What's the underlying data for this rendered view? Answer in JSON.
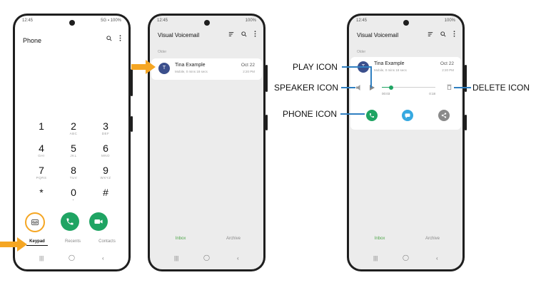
{
  "phone1": {
    "status_time": "12:45",
    "status_right": "5G",
    "status_battery": "100%",
    "title": "Phone",
    "keys": [
      {
        "digit": "1",
        "letters": ""
      },
      {
        "digit": "2",
        "letters": "ABC"
      },
      {
        "digit": "3",
        "letters": "DEF"
      },
      {
        "digit": "4",
        "letters": "GHI"
      },
      {
        "digit": "5",
        "letters": "JKL"
      },
      {
        "digit": "6",
        "letters": "MNO"
      },
      {
        "digit": "7",
        "letters": "PQRS"
      },
      {
        "digit": "8",
        "letters": "TUV"
      },
      {
        "digit": "9",
        "letters": "WXYZ"
      },
      {
        "digit": "*",
        "letters": ""
      },
      {
        "digit": "0",
        "letters": "+"
      },
      {
        "digit": "#",
        "letters": ""
      }
    ],
    "tabs": [
      "Keypad",
      "Recents",
      "Contacts"
    ]
  },
  "phone2": {
    "status_time": "12:45",
    "status_battery": "100%",
    "title": "Visual Voicemail",
    "section": "Older",
    "voicemail": {
      "initial": "T",
      "name": "Tina Example",
      "sub": "Mobile, 0 mins 18 secs",
      "date": "Oct 22",
      "time": "2:20 PM"
    },
    "tabs": [
      "Inbox",
      "Archive"
    ]
  },
  "phone3": {
    "status_time": "12:45",
    "status_battery": "100%",
    "title": "Visual Voicemail",
    "section": "Older",
    "voicemail": {
      "initial": "T",
      "name": "Tina Example",
      "sub": "Mobile, 0 mins 18 secs",
      "date": "Oct 22",
      "time": "2:20 PM"
    },
    "player": {
      "elapsed": "00:03",
      "total": "0:18",
      "progress": 0.17
    },
    "tabs": [
      "Inbox",
      "Archive"
    ]
  },
  "callouts": {
    "play": "PLAY ICON",
    "speaker": "SPEAKER ICON",
    "phone": "PHONE ICON",
    "delete": "DELETE ICON"
  },
  "colors": {
    "accent": "#f5a623",
    "green": "#1fa463",
    "blue_line": "#2f7fc1",
    "tab_active": "#4fa64a"
  }
}
